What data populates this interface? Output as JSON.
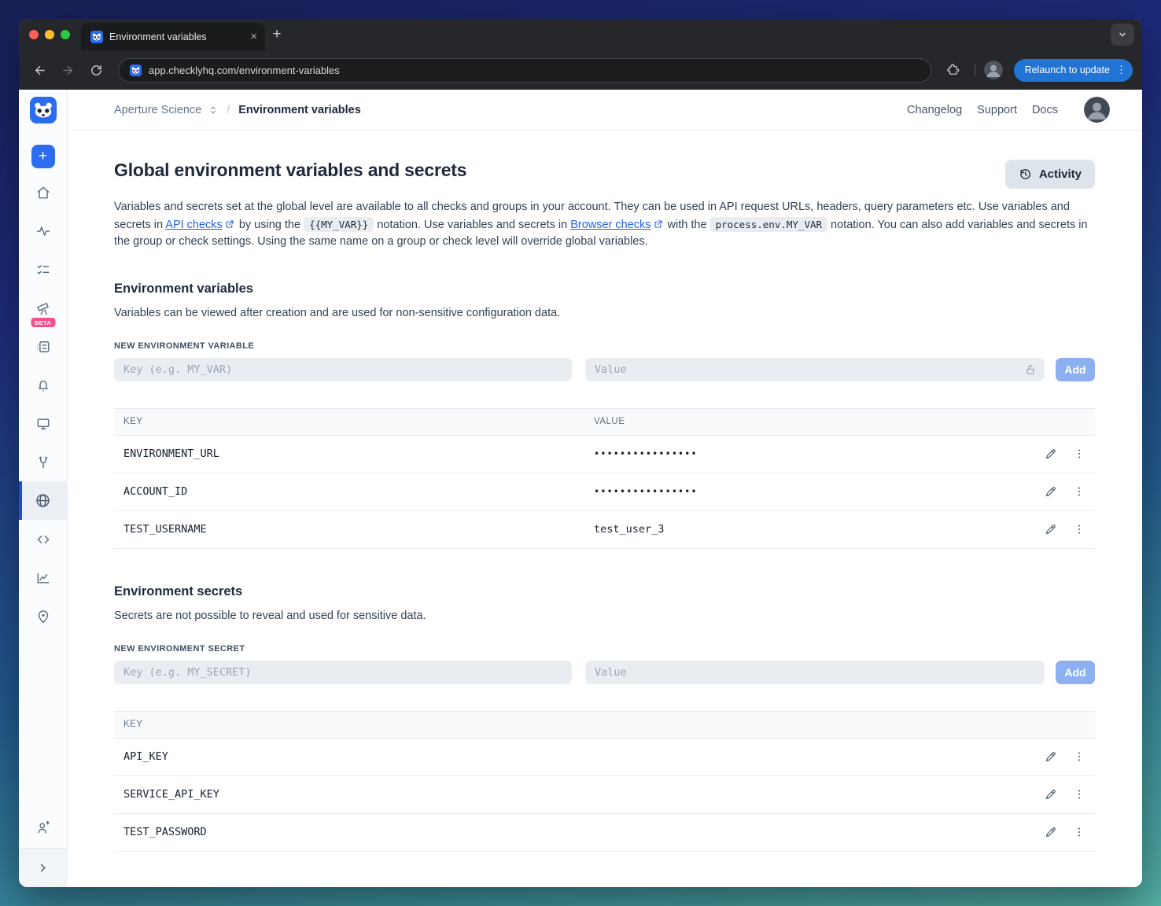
{
  "icons": {
    "close": "×",
    "plus": "+",
    "kebab": "⋮",
    "slash": "/"
  },
  "browser": {
    "tab_title": "Environment variables",
    "url_host": "app.checklyhq.com",
    "url_path": "/environment-variables",
    "relaunch_label": "Relaunch to update"
  },
  "sidebar": {
    "beta_badge": "BETA"
  },
  "header": {
    "breadcrumb_org": "Aperture Science",
    "breadcrumb_page": "Environment variables",
    "links": {
      "changelog": "Changelog",
      "support": "Support",
      "docs": "Docs"
    }
  },
  "page": {
    "title": "Global environment variables and secrets",
    "activity_label": "Activity",
    "intro": {
      "s1": "Variables and secrets set at the global level are available to all checks and groups in your account. They can be used in API request URLs, headers, query parameters etc. Use variables and secrets in ",
      "link1": "API checks",
      "s2": " by using the ",
      "code1": "{{MY_VAR}}",
      "s3": " notation. Use variables and secrets in ",
      "link2": "Browser checks",
      "s4": " with the ",
      "code2": "process.env.MY_VAR",
      "s5": " notation. You can also add variables and secrets in the group or check settings. Using the same name on a group or check level will override global variables."
    }
  },
  "variables_section": {
    "title": "Environment variables",
    "description": "Variables can be viewed after creation and are used for non-sensitive configuration data.",
    "new_label": "NEW ENVIRONMENT VARIABLE",
    "key_placeholder": "Key (e.g. MY_VAR)",
    "value_placeholder": "Value",
    "add_label": "Add",
    "table": {
      "header_key": "KEY",
      "header_value": "VALUE",
      "rows": [
        {
          "key": "ENVIRONMENT_URL",
          "value": "••••••••••••••••"
        },
        {
          "key": "ACCOUNT_ID",
          "value": "••••••••••••••••"
        },
        {
          "key": "TEST_USERNAME",
          "value": "test_user_3"
        }
      ]
    }
  },
  "secrets_section": {
    "title": "Environment secrets",
    "description": "Secrets are not possible to reveal and used for sensitive data.",
    "new_label": "NEW ENVIRONMENT SECRET",
    "key_placeholder": "Key (e.g. MY_SECRET)",
    "value_placeholder": "Value",
    "add_label": "Add",
    "table": {
      "header_key": "KEY",
      "rows": [
        {
          "key": "API_KEY"
        },
        {
          "key": "SERVICE_API_KEY"
        },
        {
          "key": "TEST_PASSWORD"
        }
      ]
    }
  }
}
